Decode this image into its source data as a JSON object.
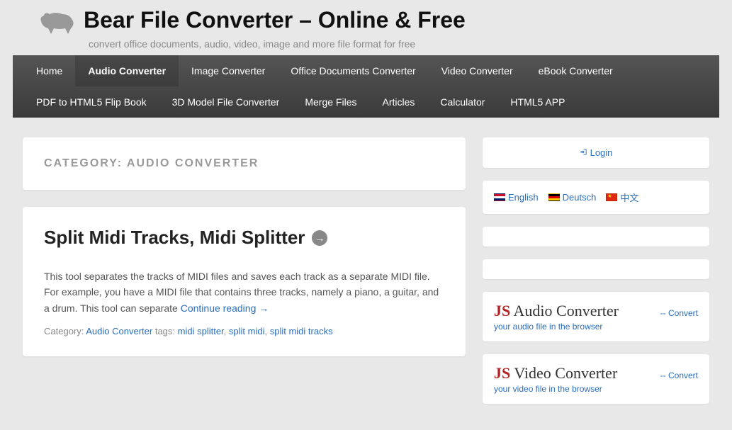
{
  "site": {
    "title": "Bear File Converter – Online & Free",
    "tagline": "convert office documents, audio, video, image and more file format for free"
  },
  "nav": {
    "items": [
      "Home",
      "Audio Converter",
      "Image Converter",
      "Office Documents Converter",
      "Video Converter",
      "eBook Converter",
      "PDF to HTML5 Flip Book",
      "3D Model File Converter",
      "Merge Files",
      "Articles",
      "Calculator",
      "HTML5 APP"
    ],
    "active_index": 1
  },
  "category": {
    "prefix": "CATEGORY: ",
    "name": "AUDIO CONVERTER"
  },
  "post": {
    "title": "Split Midi Tracks, Midi Splitter",
    "body": "This tool separates the tracks of MIDI files and saves each track as a separate MIDI file. For example, you have a MIDI file that contains three tracks, namely a piano, a guitar, and a drum. This tool can separate ",
    "read_more": "Continue reading →",
    "meta": {
      "category_label": "Category: ",
      "category_link": "Audio Converter",
      "tags_label": " tags: ",
      "tags": [
        "midi splitter",
        "split midi",
        "split midi tracks"
      ]
    }
  },
  "sidebar": {
    "login": "Login",
    "langs": {
      "en": "English",
      "de": "Deutsch",
      "cn": "中文"
    },
    "js_audio": {
      "js": "JS",
      "rest": " Audio Converter",
      "convert": "-- Convert",
      "sub": "your audio file in the browser"
    },
    "js_video": {
      "js": "JS",
      "rest": " Video Converter",
      "convert": "-- Convert",
      "sub": "your video file in the browser"
    }
  }
}
